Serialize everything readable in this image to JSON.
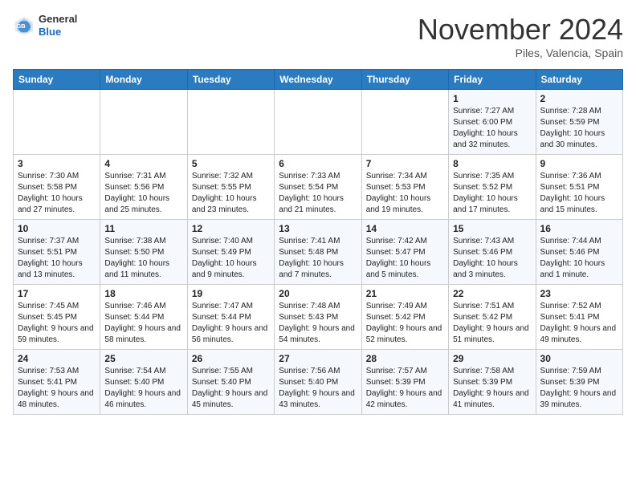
{
  "header": {
    "logo_line1": "General",
    "logo_line2": "Blue",
    "month_title": "November 2024",
    "location": "Piles, Valencia, Spain"
  },
  "weekdays": [
    "Sunday",
    "Monday",
    "Tuesday",
    "Wednesday",
    "Thursday",
    "Friday",
    "Saturday"
  ],
  "weeks": [
    [
      {
        "day": "",
        "sunrise": "",
        "sunset": "",
        "daylight": ""
      },
      {
        "day": "",
        "sunrise": "",
        "sunset": "",
        "daylight": ""
      },
      {
        "day": "",
        "sunrise": "",
        "sunset": "",
        "daylight": ""
      },
      {
        "day": "",
        "sunrise": "",
        "sunset": "",
        "daylight": ""
      },
      {
        "day": "",
        "sunrise": "",
        "sunset": "",
        "daylight": ""
      },
      {
        "day": "1",
        "sunrise": "Sunrise: 7:27 AM",
        "sunset": "Sunset: 6:00 PM",
        "daylight": "Daylight: 10 hours and 32 minutes."
      },
      {
        "day": "2",
        "sunrise": "Sunrise: 7:28 AM",
        "sunset": "Sunset: 5:59 PM",
        "daylight": "Daylight: 10 hours and 30 minutes."
      }
    ],
    [
      {
        "day": "3",
        "sunrise": "Sunrise: 7:30 AM",
        "sunset": "Sunset: 5:58 PM",
        "daylight": "Daylight: 10 hours and 27 minutes."
      },
      {
        "day": "4",
        "sunrise": "Sunrise: 7:31 AM",
        "sunset": "Sunset: 5:56 PM",
        "daylight": "Daylight: 10 hours and 25 minutes."
      },
      {
        "day": "5",
        "sunrise": "Sunrise: 7:32 AM",
        "sunset": "Sunset: 5:55 PM",
        "daylight": "Daylight: 10 hours and 23 minutes."
      },
      {
        "day": "6",
        "sunrise": "Sunrise: 7:33 AM",
        "sunset": "Sunset: 5:54 PM",
        "daylight": "Daylight: 10 hours and 21 minutes."
      },
      {
        "day": "7",
        "sunrise": "Sunrise: 7:34 AM",
        "sunset": "Sunset: 5:53 PM",
        "daylight": "Daylight: 10 hours and 19 minutes."
      },
      {
        "day": "8",
        "sunrise": "Sunrise: 7:35 AM",
        "sunset": "Sunset: 5:52 PM",
        "daylight": "Daylight: 10 hours and 17 minutes."
      },
      {
        "day": "9",
        "sunrise": "Sunrise: 7:36 AM",
        "sunset": "Sunset: 5:51 PM",
        "daylight": "Daylight: 10 hours and 15 minutes."
      }
    ],
    [
      {
        "day": "10",
        "sunrise": "Sunrise: 7:37 AM",
        "sunset": "Sunset: 5:51 PM",
        "daylight": "Daylight: 10 hours and 13 minutes."
      },
      {
        "day": "11",
        "sunrise": "Sunrise: 7:38 AM",
        "sunset": "Sunset: 5:50 PM",
        "daylight": "Daylight: 10 hours and 11 minutes."
      },
      {
        "day": "12",
        "sunrise": "Sunrise: 7:40 AM",
        "sunset": "Sunset: 5:49 PM",
        "daylight": "Daylight: 10 hours and 9 minutes."
      },
      {
        "day": "13",
        "sunrise": "Sunrise: 7:41 AM",
        "sunset": "Sunset: 5:48 PM",
        "daylight": "Daylight: 10 hours and 7 minutes."
      },
      {
        "day": "14",
        "sunrise": "Sunrise: 7:42 AM",
        "sunset": "Sunset: 5:47 PM",
        "daylight": "Daylight: 10 hours and 5 minutes."
      },
      {
        "day": "15",
        "sunrise": "Sunrise: 7:43 AM",
        "sunset": "Sunset: 5:46 PM",
        "daylight": "Daylight: 10 hours and 3 minutes."
      },
      {
        "day": "16",
        "sunrise": "Sunrise: 7:44 AM",
        "sunset": "Sunset: 5:46 PM",
        "daylight": "Daylight: 10 hours and 1 minute."
      }
    ],
    [
      {
        "day": "17",
        "sunrise": "Sunrise: 7:45 AM",
        "sunset": "Sunset: 5:45 PM",
        "daylight": "Daylight: 9 hours and 59 minutes."
      },
      {
        "day": "18",
        "sunrise": "Sunrise: 7:46 AM",
        "sunset": "Sunset: 5:44 PM",
        "daylight": "Daylight: 9 hours and 58 minutes."
      },
      {
        "day": "19",
        "sunrise": "Sunrise: 7:47 AM",
        "sunset": "Sunset: 5:44 PM",
        "daylight": "Daylight: 9 hours and 56 minutes."
      },
      {
        "day": "20",
        "sunrise": "Sunrise: 7:48 AM",
        "sunset": "Sunset: 5:43 PM",
        "daylight": "Daylight: 9 hours and 54 minutes."
      },
      {
        "day": "21",
        "sunrise": "Sunrise: 7:49 AM",
        "sunset": "Sunset: 5:42 PM",
        "daylight": "Daylight: 9 hours and 52 minutes."
      },
      {
        "day": "22",
        "sunrise": "Sunrise: 7:51 AM",
        "sunset": "Sunset: 5:42 PM",
        "daylight": "Daylight: 9 hours and 51 minutes."
      },
      {
        "day": "23",
        "sunrise": "Sunrise: 7:52 AM",
        "sunset": "Sunset: 5:41 PM",
        "daylight": "Daylight: 9 hours and 49 minutes."
      }
    ],
    [
      {
        "day": "24",
        "sunrise": "Sunrise: 7:53 AM",
        "sunset": "Sunset: 5:41 PM",
        "daylight": "Daylight: 9 hours and 48 minutes."
      },
      {
        "day": "25",
        "sunrise": "Sunrise: 7:54 AM",
        "sunset": "Sunset: 5:40 PM",
        "daylight": "Daylight: 9 hours and 46 minutes."
      },
      {
        "day": "26",
        "sunrise": "Sunrise: 7:55 AM",
        "sunset": "Sunset: 5:40 PM",
        "daylight": "Daylight: 9 hours and 45 minutes."
      },
      {
        "day": "27",
        "sunrise": "Sunrise: 7:56 AM",
        "sunset": "Sunset: 5:40 PM",
        "daylight": "Daylight: 9 hours and 43 minutes."
      },
      {
        "day": "28",
        "sunrise": "Sunrise: 7:57 AM",
        "sunset": "Sunset: 5:39 PM",
        "daylight": "Daylight: 9 hours and 42 minutes."
      },
      {
        "day": "29",
        "sunrise": "Sunrise: 7:58 AM",
        "sunset": "Sunset: 5:39 PM",
        "daylight": "Daylight: 9 hours and 41 minutes."
      },
      {
        "day": "30",
        "sunrise": "Sunrise: 7:59 AM",
        "sunset": "Sunset: 5:39 PM",
        "daylight": "Daylight: 9 hours and 39 minutes."
      }
    ]
  ]
}
